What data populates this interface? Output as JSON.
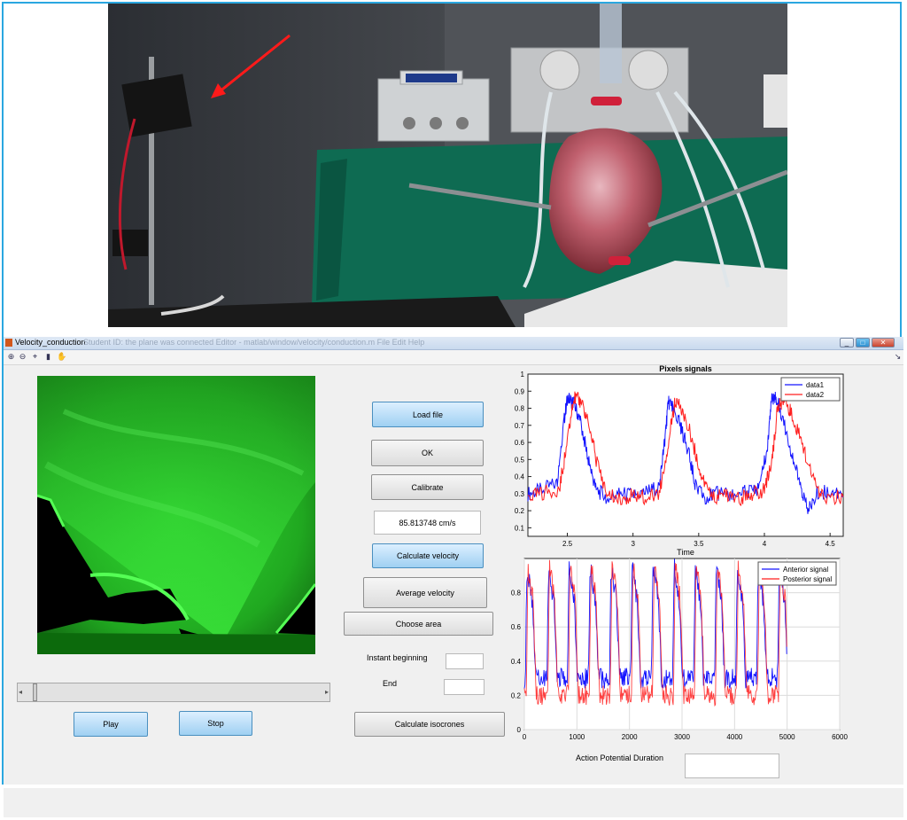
{
  "window": {
    "title": "Velocity_conduction",
    "title_faded": "Student ID: the plane was connected   Editor - matlab/window/velocity/conduction.m  File  Edit  Help",
    "controls": [
      "_",
      "□",
      "✕"
    ]
  },
  "toolbar": {
    "tools": [
      "zoom-in-icon",
      "zoom-out-icon",
      "data-cursor-icon",
      "colorbar-icon",
      "pan-icon"
    ]
  },
  "buttons": {
    "load_file": "Load file",
    "ok": "OK",
    "calibrate": "Calibrate",
    "calculate_velocity": "Calculate velocity",
    "average_velocity": "Average velocity",
    "choose_area": "Choose area",
    "calculate_isocrones": "Calculate isocrones",
    "play": "Play",
    "stop": "Stop"
  },
  "fields": {
    "velocity_value": "85.813748 cm/s",
    "instant_beginning_label": "Instant beginning",
    "instant_beginning_value": "",
    "end_label": "End",
    "end_value": "",
    "apd_label": "Action Potential Duration",
    "apd_value": ""
  },
  "slider": {
    "position": 0.02
  },
  "colors": {
    "accent": "#2aa7e0",
    "data1": "#1414ff",
    "data2": "#ff1e1e",
    "fluorescence": "#33dd33"
  },
  "chart_data": [
    {
      "type": "line",
      "title": "Pixels signals",
      "xlabel": "Time",
      "ylabel": "",
      "xlim": [
        2.2,
        4.6
      ],
      "ylim": [
        0.05,
        1.0
      ],
      "xticks": [
        "2.5",
        "3",
        "3.5",
        "4",
        "4.5"
      ],
      "yticks": [
        "0.1",
        "0.2",
        "0.3",
        "0.4",
        "0.5",
        "0.6",
        "0.7",
        "0.8",
        "0.9",
        "1"
      ],
      "grid": false,
      "legend_position": "top-right",
      "series": [
        {
          "name": "data1",
          "color": "#1414ff",
          "x": [
            2.2,
            2.3,
            2.42,
            2.47,
            2.5,
            2.55,
            2.6,
            2.66,
            2.72,
            2.8,
            2.9,
            3.0,
            3.1,
            3.2,
            3.24,
            3.27,
            3.3,
            3.36,
            3.42,
            3.48,
            3.55,
            3.65,
            3.75,
            3.85,
            3.95,
            4.02,
            4.05,
            4.08,
            4.12,
            4.2,
            4.27,
            4.33,
            4.4,
            4.5,
            4.6
          ],
          "y": [
            0.3,
            0.32,
            0.36,
            0.7,
            0.86,
            0.83,
            0.72,
            0.5,
            0.32,
            0.28,
            0.3,
            0.29,
            0.31,
            0.34,
            0.6,
            0.84,
            0.8,
            0.7,
            0.55,
            0.33,
            0.28,
            0.3,
            0.29,
            0.31,
            0.33,
            0.55,
            0.84,
            0.87,
            0.8,
            0.56,
            0.35,
            0.2,
            0.3,
            0.32,
            0.28
          ]
        },
        {
          "name": "data2",
          "color": "#ff1e1e",
          "x": [
            2.2,
            2.3,
            2.44,
            2.5,
            2.55,
            2.6,
            2.66,
            2.72,
            2.8,
            2.9,
            3.0,
            3.1,
            3.2,
            3.27,
            3.32,
            3.38,
            3.45,
            3.52,
            3.6,
            3.7,
            3.8,
            3.9,
            4.0,
            4.06,
            4.1,
            4.15,
            4.2,
            4.28,
            4.36,
            4.45,
            4.6
          ],
          "y": [
            0.28,
            0.3,
            0.33,
            0.6,
            0.86,
            0.84,
            0.72,
            0.5,
            0.3,
            0.27,
            0.29,
            0.28,
            0.3,
            0.6,
            0.84,
            0.78,
            0.62,
            0.4,
            0.28,
            0.29,
            0.27,
            0.3,
            0.32,
            0.5,
            0.8,
            0.86,
            0.78,
            0.62,
            0.4,
            0.27,
            0.28
          ]
        }
      ]
    },
    {
      "type": "line",
      "title": "",
      "xlabel": "",
      "ylabel": "",
      "xlim": [
        0,
        6000
      ],
      "ylim": [
        0,
        1
      ],
      "xticks": [
        "0",
        "1000",
        "2000",
        "3000",
        "4000",
        "5000",
        "6000"
      ],
      "yticks": [
        "0",
        "0.2",
        "0.4",
        "0.6",
        "0.8"
      ],
      "grid": true,
      "legend_position": "top-right",
      "beats_x": [
        20,
        430,
        820,
        1220,
        1620,
        2020,
        2420,
        2820,
        3220,
        3620,
        4020,
        4420,
        4820
      ],
      "series": [
        {
          "name": "Anterior signal",
          "color": "#1414ff",
          "peak": 0.95,
          "baseline": 0.3,
          "end_x": 5000
        },
        {
          "name": "Posterior signal",
          "color": "#ff1e1e",
          "peak": 0.97,
          "baseline": 0.2,
          "end_x": 5000
        }
      ]
    }
  ]
}
